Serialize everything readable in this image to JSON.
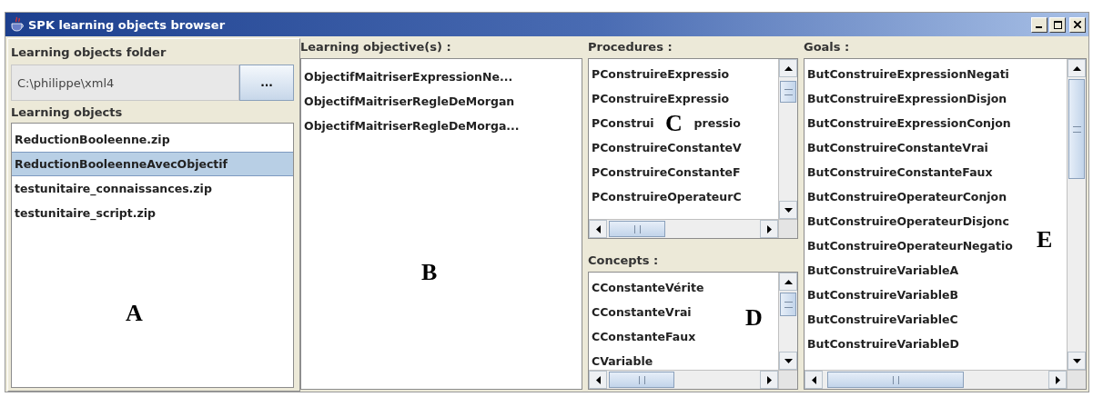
{
  "window": {
    "title": "SPK learning objects browser"
  },
  "folder_panel": {
    "label": "Learning objects folder",
    "path": "C:\\philippe\\xml4",
    "browse_button": "...",
    "list_label": "Learning objects",
    "annotation": "A",
    "items": [
      {
        "text": "ReductionBooleenne.zip",
        "selected": false
      },
      {
        "text": "ReductionBooleenneAvecObjectif",
        "selected": true
      },
      {
        "text": "testunitaire_connaissances.zip",
        "selected": false
      },
      {
        "text": "testunitaire_script.zip",
        "selected": false
      }
    ]
  },
  "objectives": {
    "label": "Learning objective(s) :",
    "annotation": "B",
    "items": [
      {
        "parts": [
          "ObjectifMaitriserExpressionNe..."
        ]
      },
      {
        "parts": [
          "ObjectifMaitriserRegleDeMorgan"
        ]
      },
      {
        "parts": [
          "ObjectifMaitriserRegleDeMorga..."
        ]
      }
    ]
  },
  "procedures": {
    "label": "Procedures :",
    "annotation": "C",
    "items": [
      {
        "parts": [
          "PConstruireExpressio"
        ]
      },
      {
        "parts": [
          "PConstruireExpressio"
        ]
      },
      {
        "parts": [
          "PConstrui",
          "pressio"
        ]
      },
      {
        "parts": [
          "PConstruireConstanteV"
        ]
      },
      {
        "parts": [
          "PConstruireConstanteF"
        ]
      },
      {
        "parts": [
          "PConstruireOperateurC"
        ]
      }
    ]
  },
  "concepts": {
    "label": "Concepts :",
    "annotation": "D",
    "items": [
      {
        "parts": [
          "CConstanteVérite"
        ]
      },
      {
        "parts": [
          "CConstanteVrai"
        ]
      },
      {
        "parts": [
          "CConstanteFaux"
        ]
      },
      {
        "parts": [
          "CVariable"
        ]
      }
    ]
  },
  "goals": {
    "label": "Goals :",
    "annotation": "E",
    "items": [
      {
        "parts": [
          "ButConstruireExpressionNegati"
        ]
      },
      {
        "parts": [
          "ButConstruireExpressionDisjon"
        ]
      },
      {
        "parts": [
          "ButConstruireExpressionConjon"
        ]
      },
      {
        "parts": [
          "ButConstruireConstanteVrai"
        ]
      },
      {
        "parts": [
          "ButConstruireConstanteFaux"
        ]
      },
      {
        "parts": [
          "ButConstruireOperateurConjon"
        ]
      },
      {
        "parts": [
          "ButConstruireOperateurDisjonc"
        ]
      },
      {
        "parts": [
          "ButConstruireOperateurNegatio"
        ]
      },
      {
        "parts": [
          "ButConstruireVariableA"
        ]
      },
      {
        "parts": [
          "ButConstruireVariableB"
        ]
      },
      {
        "parts": [
          "ButConstruireVariableC"
        ]
      },
      {
        "parts": [
          "ButConstruireVariableD"
        ]
      }
    ]
  }
}
